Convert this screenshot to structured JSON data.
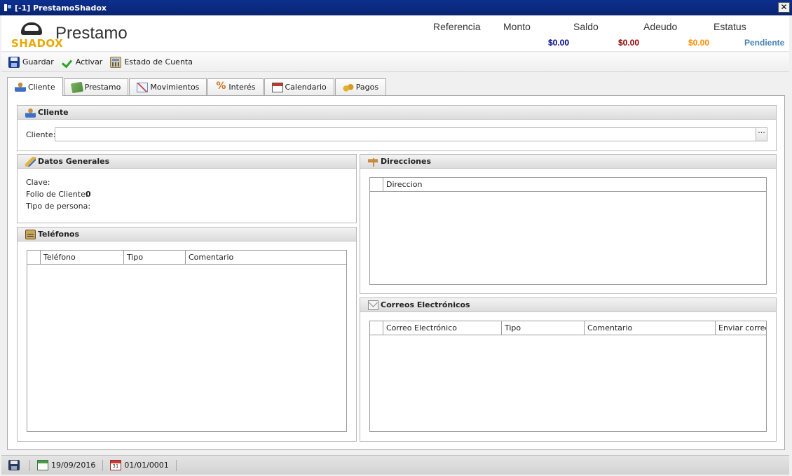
{
  "window": {
    "title": "[-1] PrestamoShadox",
    "close_label": "✕"
  },
  "header": {
    "brand": "SHADOX",
    "title": "Prestamo",
    "summary": [
      {
        "key": "referencia",
        "label": "Referencia",
        "value": ""
      },
      {
        "key": "monto",
        "label": "Monto",
        "value": "$0.00",
        "color": "#00008b"
      },
      {
        "key": "saldo",
        "label": "Saldo",
        "value": "$0.00",
        "color": "#8b0000"
      },
      {
        "key": "adeudo",
        "label": "Adeudo",
        "value": "$0.00",
        "color": "#ff8c00"
      },
      {
        "key": "estatus",
        "label": "Estatus",
        "value": "Pendiente",
        "color": "#4682b4"
      }
    ]
  },
  "toolbar": {
    "save_label": "Guardar",
    "activate_label": "Activar",
    "statement_label": "Estado de Cuenta"
  },
  "tabs": [
    {
      "label": "Cliente",
      "icon": "user-card-icon",
      "active": true
    },
    {
      "label": "Prestamo",
      "icon": "money-icon"
    },
    {
      "label": "Movimientos",
      "icon": "chart-icon"
    },
    {
      "label": "Interés",
      "icon": "percent-icon"
    },
    {
      "label": "Calendario",
      "icon": "calendar-icon"
    },
    {
      "label": "Pagos",
      "icon": "coins-icon"
    }
  ],
  "cliente_group": {
    "title": "Cliente",
    "field_label": "Cliente:",
    "field_value": "",
    "lookup_label": "···"
  },
  "datos_generales": {
    "title": "Datos Generales",
    "clave_label": "Clave:",
    "clave_value": "",
    "folio_label": "Folio de Cliente:",
    "folio_value": "0",
    "tipo_persona_label": "Tipo de persona:",
    "tipo_persona_value": ""
  },
  "telefonos": {
    "title": "Teléfonos",
    "columns": [
      "",
      "Teléfono",
      "Tipo",
      "Comentario"
    ]
  },
  "direcciones": {
    "title": "Direcciones",
    "columns": [
      "",
      "Direccion"
    ]
  },
  "correos": {
    "title": "Correos Electrónicos",
    "columns": [
      "",
      "Correo Electrónico",
      "Tipo",
      "Comentario",
      "Enviar correo"
    ]
  },
  "statusbar": {
    "date_1": "19/09/2016",
    "date_2": "01/01/0001"
  }
}
